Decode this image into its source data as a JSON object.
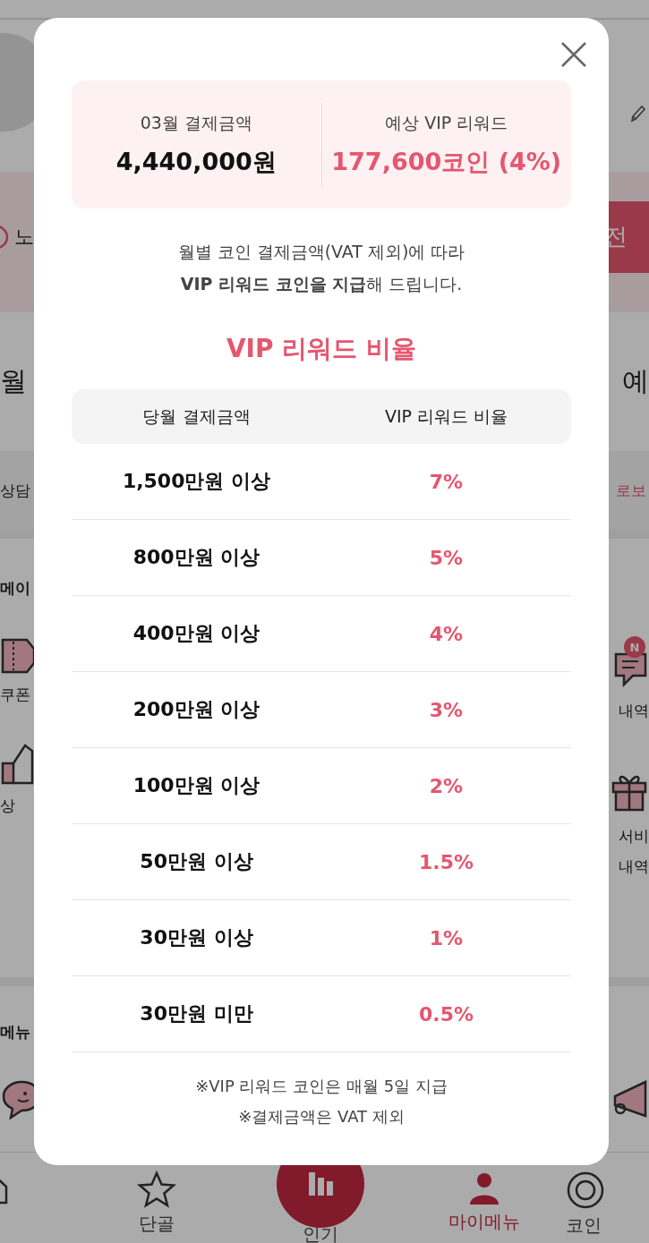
{
  "background": {
    "alert_row": {
      "text": "노",
      "button": "전"
    },
    "stats_row": {
      "left_text": "월",
      "right_text": "예"
    },
    "consult_row": {
      "left_text": "상담",
      "link": "로보"
    },
    "section_1": {
      "title": "메이",
      "left_items": [
        {
          "kind": "coupon",
          "lines": [
            "쿠폰"
          ]
        },
        {
          "kind": "thumb",
          "lines": [
            "상"
          ]
        }
      ],
      "right_items": [
        {
          "kind": "chat",
          "lines": [
            "내역"
          ],
          "badge": "N"
        },
        {
          "kind": "gift",
          "lines": [
            "서비",
            "내역"
          ]
        }
      ]
    },
    "section_2": {
      "title": "메뉴"
    },
    "bottom_nav": [
      {
        "kind": "home",
        "selected": false
      },
      {
        "kind": "star",
        "label": "단골",
        "selected": false
      },
      {
        "kind": "center",
        "label": "인기",
        "selected": false
      },
      {
        "kind": "person",
        "label": "마이메뉴",
        "selected": true
      },
      {
        "kind": "coin",
        "label": "코인",
        "selected": false
      }
    ]
  },
  "modal": {
    "summary": [
      {
        "label": "03월 결제금액",
        "value": "4,440,000원",
        "highlight": false
      },
      {
        "label": "예상 VIP 리워드",
        "value": "177,600코인 (4%)",
        "highlight": true
      }
    ],
    "description": [
      "월별 코인 결제금액(VAT 제외)에 따라",
      "**VIP 리워드 코인을 지급**해 드립니다."
    ],
    "title": "VIP 리워드 비율",
    "table": {
      "columns": [
        "당월 결제금액",
        "VIP 리워드 비율"
      ],
      "rows": [
        [
          "1,500만원 이상",
          "7%"
        ],
        [
          "800만원 이상",
          "5%"
        ],
        [
          "400만원 이상",
          "4%"
        ],
        [
          "200만원 이상",
          "3%"
        ],
        [
          "100만원 이상",
          "2%"
        ],
        [
          "50만원 이상",
          "1.5%"
        ],
        [
          "30만원 이상",
          "1%"
        ],
        [
          "30만원 미만",
          "0.5%"
        ]
      ]
    },
    "notes": [
      "※VIP 리워드 코인은 매월 5일 지급",
      "※결제금액은 VAT 제외"
    ]
  }
}
